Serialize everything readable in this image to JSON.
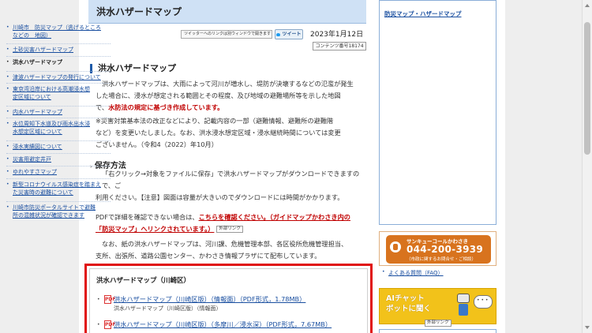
{
  "page_title": "洪水ハザードマップ",
  "tweet_note": "ツイッターへのリンクは別ウィンドウで開きます",
  "tweet_button": "ツイート",
  "date": "2023年1月12日",
  "content_number": "コンテンツ番号18174",
  "section_heading": "洪水ハザードマップ",
  "intro": {
    "line1": "洪水ハザードマップは、大雨によって河川が増水し、堤防が決壊するなどの氾濫が発生",
    "line2": "した場合に、浸水が想定される範囲とその程度、及び地域の避難場所等を示した地図",
    "line3_prefix": "で、",
    "line3_red": "水防法の規定に基づき作成しています。"
  },
  "note": {
    "line1": "※災害対策基本法の改正などにより、記載内容の一部（避難情報、避難所の避難階",
    "line2": "など）を変更いたしました。なお、洪水浸水想定区域・浸水継続時間については変更",
    "line3": "ございません。（令和4（2022）年10月）"
  },
  "save_heading": "保存方法",
  "save": {
    "line1": "「右クリック→対象をファイルに保存」で洪水ハザードマップがダウンロードできますので、ご",
    "line2": "利用ください。【注意】図面は容量が大きいのでダウンロードには時間がかかります。"
  },
  "pdf_note": {
    "prefix": "PDFで詳細を確認できない場合は、",
    "link": "こちらを確認ください。（ガイドマップかわさき内の",
    "link2": "「防災マップ」へリンクされています。）",
    "ext": "外部リンク"
  },
  "distribution": {
    "line1": "なお、紙の洪水ハザードマップは、河川課、危機管理本部、各区役所危機管理担当、",
    "line2": "支所、出張所、道路公園センター、かわさき情報プラザにて配布しています。"
  },
  "kawasaki_box": {
    "title": "洪水ハザードマップ（川崎区）",
    "items": [
      {
        "icon": "PDF",
        "link": "洪水ハザードマップ（川崎区版）（情報面）（PDF形式，1.78MB）",
        "sub": "洪水ハザードマップ（川崎区版）（情報面）"
      },
      {
        "icon": "PDF",
        "link": "洪水ハザードマップ（川崎区版）（多摩川／浸水深）（PDF形式，7.67MB）",
        "sub": ""
      }
    ]
  },
  "sidebar": {
    "heading": "防災マップ・ハザードマップ",
    "items": [
      {
        "label1": "川崎市　防災マップ（逃げるところ",
        "label2": "などの　地図）",
        "current": false
      },
      {
        "label1": "土砂災害ハザードマップ",
        "label2": "",
        "current": false
      },
      {
        "label1": "洪水ハザードマップ",
        "label2": "",
        "current": true
      },
      {
        "label1": "津波ハザードマップの発行について",
        "label2": "",
        "current": false
      },
      {
        "label1": "東京湾沿岸における高潮浸水想",
        "label2": "定区域について",
        "current": false
      },
      {
        "label1": "内水ハザードマップ",
        "label2": "",
        "current": false
      },
      {
        "label1": "水位周知下水道及び雨水出水浸",
        "label2": "水想定区域について",
        "current": false
      },
      {
        "label1": "浸水実績図について",
        "label2": "",
        "current": false
      },
      {
        "label1": "災害用避定井戸",
        "label2": "",
        "current": false
      },
      {
        "label1": "ゆれやすさマップ",
        "label2": "",
        "current": false
      },
      {
        "label1": "新型コロナウイルス感染症を踏まえ",
        "label2": "た災害時の避難について",
        "current": false
      },
      {
        "label1": "川崎市防災ポータルサイトで避難",
        "label2": "所の混雑状況が確認できます",
        "current": false
      }
    ]
  },
  "call_banner": {
    "line1": "サンキューコールかわさき",
    "number": "044-200-3939",
    "line3": "（市政に関するお問合せ・ご相談）"
  },
  "faq": "よくある質問（FAQ）",
  "ai_banner": {
    "line1": "AIチャット",
    "line2": "ボットに聞く",
    "ext": "外部リンク"
  },
  "colors": {
    "title_bg": "#cfe1f5",
    "accent": "#1e5aa8",
    "warning": "#c00000",
    "highlight": "#e01010",
    "call": "#d8731e",
    "ai": "#f2c21a"
  }
}
